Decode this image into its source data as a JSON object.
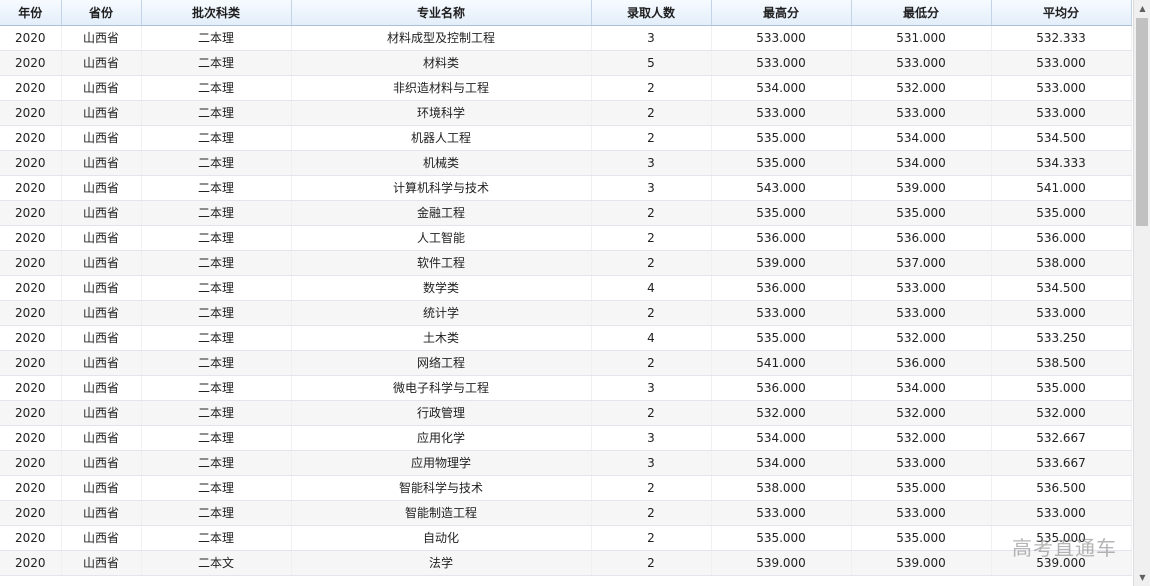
{
  "columns": [
    "年份",
    "省份",
    "批次科类",
    "专业名称",
    "录取人数",
    "最高分",
    "最低分",
    "平均分"
  ],
  "rows": [
    [
      "2020",
      "山西省",
      "二本理",
      "材料成型及控制工程",
      "3",
      "533.000",
      "531.000",
      "532.333"
    ],
    [
      "2020",
      "山西省",
      "二本理",
      "材料类",
      "5",
      "533.000",
      "533.000",
      "533.000"
    ],
    [
      "2020",
      "山西省",
      "二本理",
      "非织造材料与工程",
      "2",
      "534.000",
      "532.000",
      "533.000"
    ],
    [
      "2020",
      "山西省",
      "二本理",
      "环境科学",
      "2",
      "533.000",
      "533.000",
      "533.000"
    ],
    [
      "2020",
      "山西省",
      "二本理",
      "机器人工程",
      "2",
      "535.000",
      "534.000",
      "534.500"
    ],
    [
      "2020",
      "山西省",
      "二本理",
      "机械类",
      "3",
      "535.000",
      "534.000",
      "534.333"
    ],
    [
      "2020",
      "山西省",
      "二本理",
      "计算机科学与技术",
      "3",
      "543.000",
      "539.000",
      "541.000"
    ],
    [
      "2020",
      "山西省",
      "二本理",
      "金融工程",
      "2",
      "535.000",
      "535.000",
      "535.000"
    ],
    [
      "2020",
      "山西省",
      "二本理",
      "人工智能",
      "2",
      "536.000",
      "536.000",
      "536.000"
    ],
    [
      "2020",
      "山西省",
      "二本理",
      "软件工程",
      "2",
      "539.000",
      "537.000",
      "538.000"
    ],
    [
      "2020",
      "山西省",
      "二本理",
      "数学类",
      "4",
      "536.000",
      "533.000",
      "534.500"
    ],
    [
      "2020",
      "山西省",
      "二本理",
      "统计学",
      "2",
      "533.000",
      "533.000",
      "533.000"
    ],
    [
      "2020",
      "山西省",
      "二本理",
      "土木类",
      "4",
      "535.000",
      "532.000",
      "533.250"
    ],
    [
      "2020",
      "山西省",
      "二本理",
      "网络工程",
      "2",
      "541.000",
      "536.000",
      "538.500"
    ],
    [
      "2020",
      "山西省",
      "二本理",
      "微电子科学与工程",
      "3",
      "536.000",
      "534.000",
      "535.000"
    ],
    [
      "2020",
      "山西省",
      "二本理",
      "行政管理",
      "2",
      "532.000",
      "532.000",
      "532.000"
    ],
    [
      "2020",
      "山西省",
      "二本理",
      "应用化学",
      "3",
      "534.000",
      "532.000",
      "532.667"
    ],
    [
      "2020",
      "山西省",
      "二本理",
      "应用物理学",
      "3",
      "534.000",
      "533.000",
      "533.667"
    ],
    [
      "2020",
      "山西省",
      "二本理",
      "智能科学与技术",
      "2",
      "538.000",
      "535.000",
      "536.500"
    ],
    [
      "2020",
      "山西省",
      "二本理",
      "智能制造工程",
      "2",
      "533.000",
      "533.000",
      "533.000"
    ],
    [
      "2020",
      "山西省",
      "二本理",
      "自动化",
      "2",
      "535.000",
      "535.000",
      "535.000"
    ],
    [
      "2020",
      "山西省",
      "二本文",
      "法学",
      "2",
      "539.000",
      "539.000",
      "539.000"
    ]
  ],
  "watermark": "高考直通车",
  "icons": {
    "scroll_up": "triangle-up-icon",
    "scroll_down": "triangle-down-icon"
  }
}
